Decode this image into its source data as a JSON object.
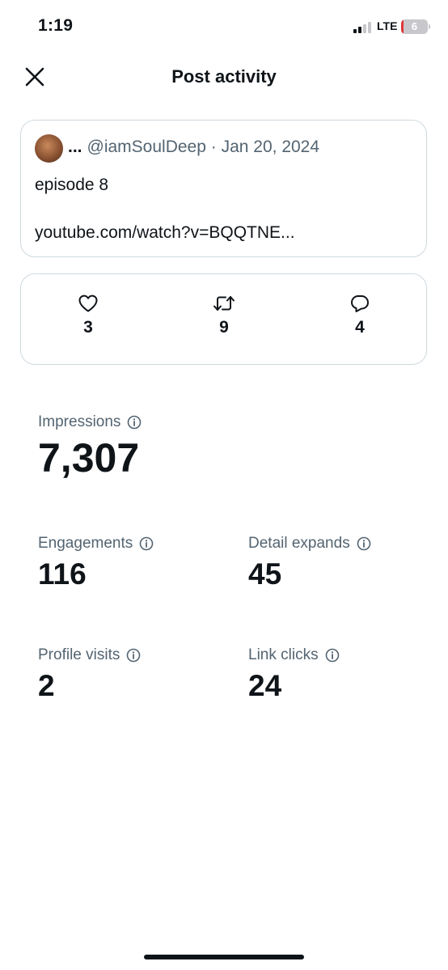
{
  "status_bar": {
    "time": "1:19",
    "network": "LTE",
    "battery_level": "6",
    "signal_bars_active": 2,
    "signal_bars_total": 4
  },
  "header": {
    "title": "Post activity"
  },
  "post": {
    "author_ellipsis": "...",
    "handle": "@iamSoulDeep",
    "separator": "·",
    "date": "Jan 20, 2024",
    "text": "episode 8",
    "link": "youtube.com/watch?v=BQQTNE..."
  },
  "engagement": {
    "likes": "3",
    "reposts": "9",
    "replies": "4"
  },
  "metrics": {
    "impressions": {
      "label": "Impressions",
      "value": "7,307"
    },
    "engagements": {
      "label": "Engagements",
      "value": "116"
    },
    "detail_expands": {
      "label": "Detail expands",
      "value": "45"
    },
    "profile_visits": {
      "label": "Profile visits",
      "value": "2"
    },
    "link_clicks": {
      "label": "Link clicks",
      "value": "24"
    }
  },
  "colors": {
    "text_primary": "#0f1419",
    "text_secondary": "#536471",
    "border": "#cfd9de",
    "battery_low": "#e0363a"
  },
  "icons": [
    "close-icon",
    "heart-icon",
    "repost-icon",
    "reply-icon",
    "info-icon"
  ]
}
